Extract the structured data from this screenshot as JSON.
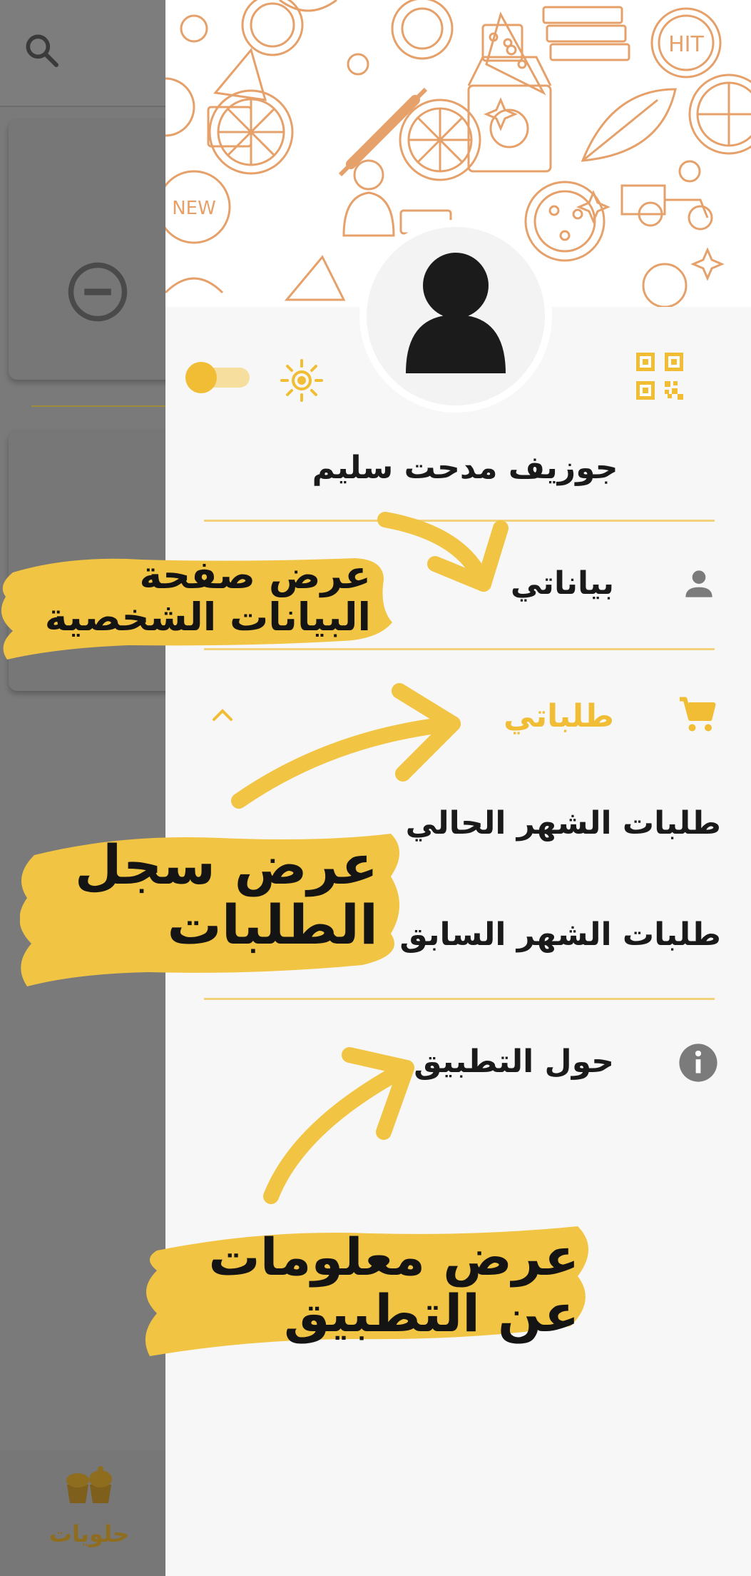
{
  "background_app": {
    "bottom_tab_label": "حلويات"
  },
  "drawer": {
    "user_name": "جوزيف مدحت سليم",
    "menu": {
      "profile_label": "بياناتي",
      "orders_label": "طلباتي",
      "current_month_orders": "طلبات الشهر الحالي",
      "previous_month_orders": "طلبات الشهر السابق",
      "about_label": "حول التطبيق"
    },
    "theme_toggle_on": true
  },
  "callouts": {
    "profile_line1": "عرض صفحة",
    "profile_line2": "البيانات الشخصية",
    "orders_line1": "عرض سجل",
    "orders_line2": "الطلبات",
    "about_line1": "عرض معلومات",
    "about_line2": "عن التطبيق"
  },
  "header_pattern_texts": {
    "hit": "HIT",
    "new": "NEW"
  },
  "colors": {
    "accent_yellow": "#f1bd34",
    "pattern_orange": "#e6a06a",
    "scrim_gray": "#7a7a7a",
    "drawer_bg": "#f7f7f7",
    "icon_gray": "#7b7b7b"
  }
}
